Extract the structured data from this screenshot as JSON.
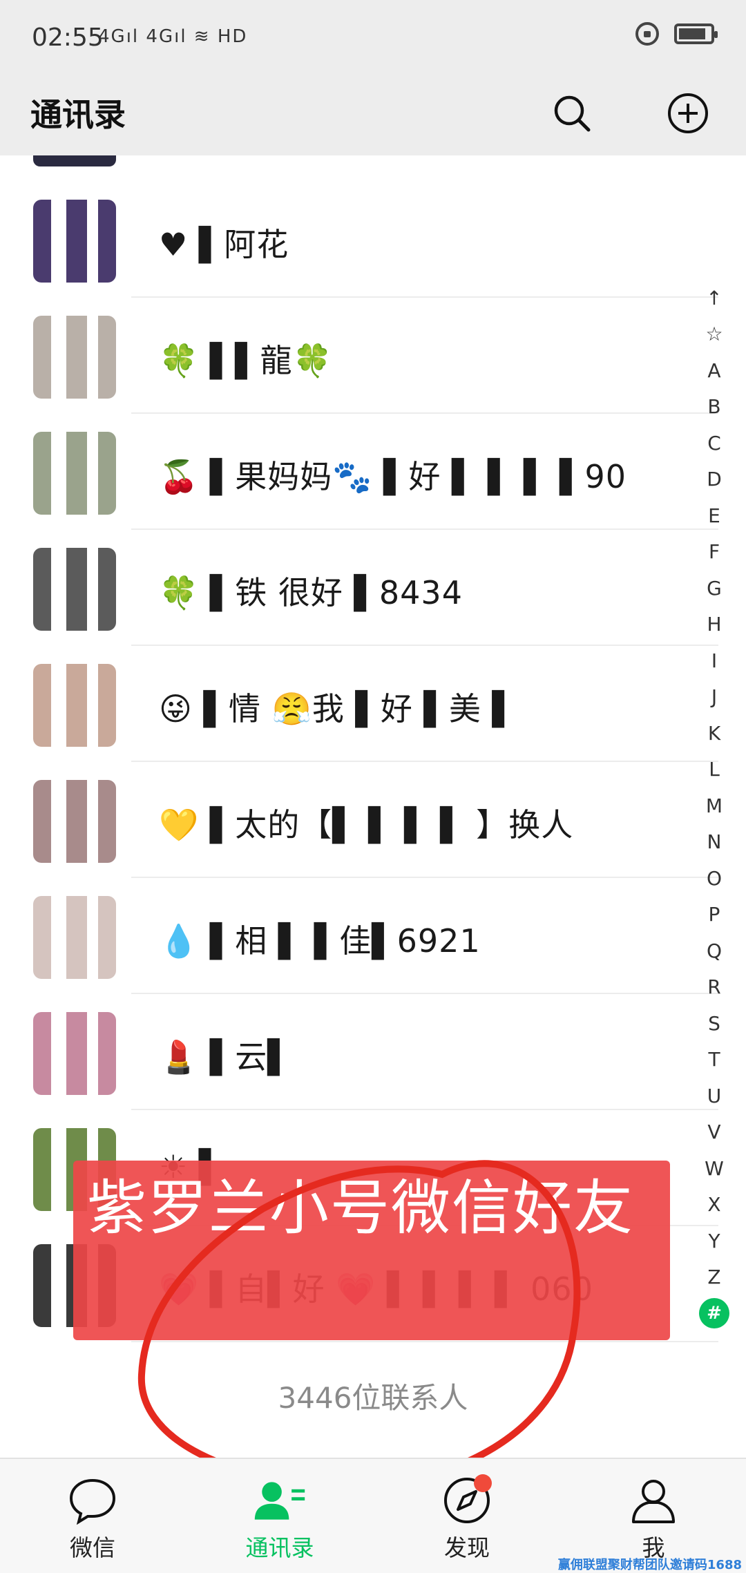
{
  "status_bar": {
    "time": "02:55",
    "signal": "4Gıl 4Gıl ≋ HD",
    "lock_icon": "lock-rotation-icon",
    "battery_icon": "battery-icon"
  },
  "header": {
    "title": "通讯录",
    "search_icon": "search-icon",
    "add_icon": "plus-circle-icon"
  },
  "contacts": [
    {
      "name": "♥ ▌阿花",
      "avatar_color": "#4a3b6e"
    },
    {
      "name": "🍀 ▌▌龍🍀",
      "avatar_color": "#b9b0a8"
    },
    {
      "name": "🍒 ▌果妈妈🐾 ▌好 ▌ ▌ ▌ ▌90",
      "avatar_color": "#9aa38c"
    },
    {
      "name": "🍀 ▌铁 很好 ▌8434",
      "avatar_color": "#5b5b5b"
    },
    {
      "name": "😜 ▌情 😤我 ▌好 ▌美 ▌",
      "avatar_color": "#c9a99a"
    },
    {
      "name": "💛 ▌太的【▌ ▌ ▌ ▌ 】换人",
      "avatar_color": "#a88b8b"
    },
    {
      "name": "💧 ▌相 ▌ ▌佳▌6921",
      "avatar_color": "#d5c4bf"
    },
    {
      "name": "💄 ▌云▌",
      "avatar_color": "#c78aa0"
    },
    {
      "name": "☀ ▌",
      "avatar_color": "#6f8c4a"
    },
    {
      "name": "💗 ▌自▌好 💗 ▌ ▌ ▌ ▌ 060",
      "avatar_color": "#3a3a3a"
    }
  ],
  "alpha_index": [
    "↑",
    "☆",
    "A",
    "B",
    "C",
    "D",
    "E",
    "F",
    "G",
    "H",
    "I",
    "J",
    "K",
    "L",
    "M",
    "N",
    "O",
    "P",
    "Q",
    "R",
    "S",
    "T",
    "U",
    "V",
    "W",
    "X",
    "Y",
    "Z",
    "#"
  ],
  "alpha_active": "#",
  "contact_count": "3446位联系人",
  "annotation": "紫罗兰小号微信好友",
  "tabs": [
    {
      "label": "微信",
      "icon": "chat-bubble-icon",
      "active": false
    },
    {
      "label": "通讯录",
      "icon": "contacts-icon",
      "active": true
    },
    {
      "label": "发现",
      "icon": "compass-icon",
      "active": false
    },
    {
      "label": "我",
      "icon": "person-icon",
      "active": false
    }
  ],
  "watermark": "赢佣联盟聚财帮团队邀请码1688",
  "colors": {
    "accent": "#07c160",
    "header_bg": "#ededed",
    "annotation_bg": "#ee4648",
    "badge_red": "#f04a3a"
  }
}
